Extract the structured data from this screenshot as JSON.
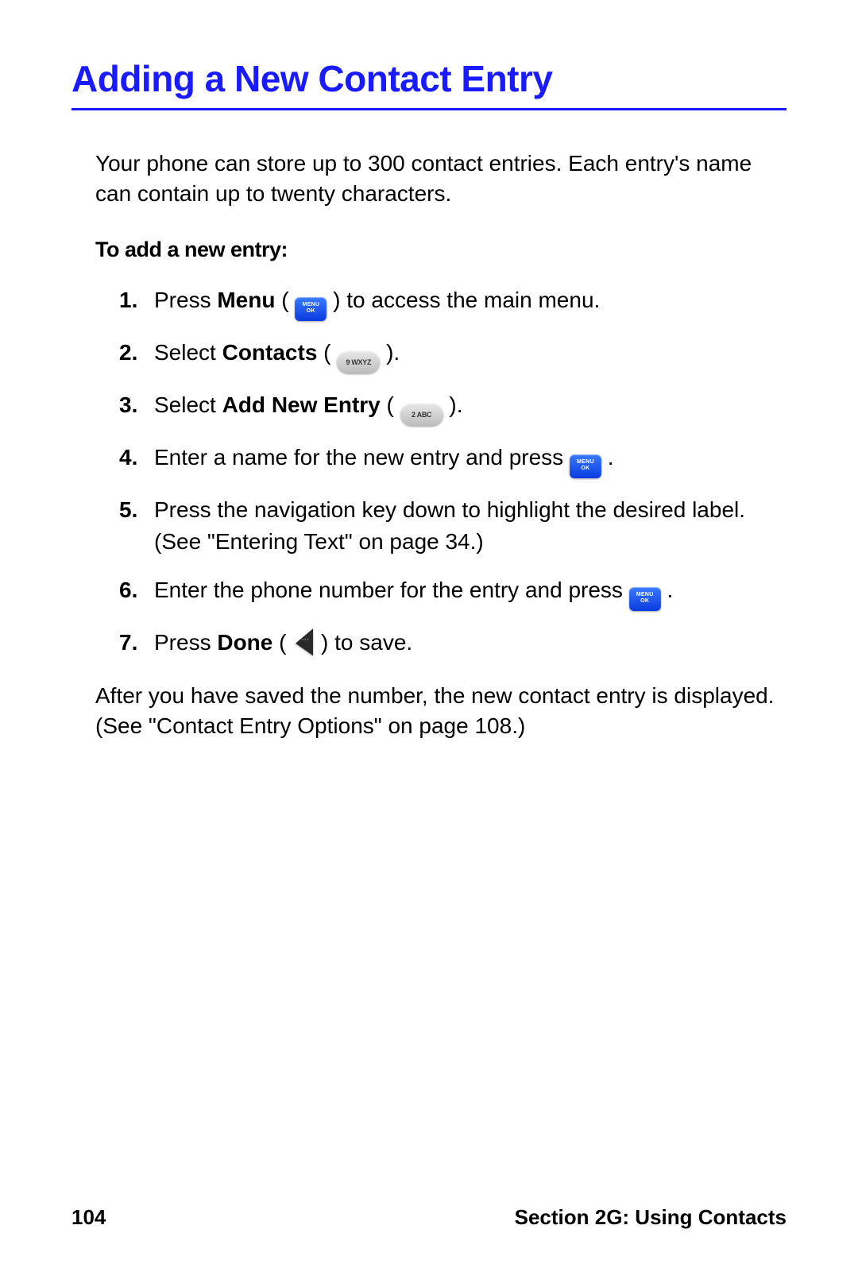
{
  "title": "Adding a New Contact Entry",
  "intro": "Your phone can store up to 300 contact entries. Each entry's name can contain up to twenty characters.",
  "subhead": "To add a new entry:",
  "steps": {
    "s1a": "Press ",
    "s1b": "Menu",
    "s1c": " ( ",
    "s1d": " ) to access the main menu.",
    "s2a": "Select ",
    "s2b": "Contacts",
    "s2c": " ( ",
    "s2d": " ).",
    "s3a": "Select ",
    "s3b": "Add New Entry",
    "s3c": " ( ",
    "s3d": " ).",
    "s4a": "Enter a name for the new entry and press ",
    "s4b": " .",
    "s5": "Press the navigation key down to highlight the desired label. (See \"Entering Text\" on page 34.)",
    "s6a": "Enter the phone number for the entry and press ",
    "s6b": " .",
    "s7a": "Press ",
    "s7b": "Done",
    "s7c": " ( ",
    "s7d": " ) to save."
  },
  "after": "After you have saved the number, the new contact entry is displayed. (See \"Contact Entry Options\" on page 108.)",
  "footer": {
    "page": "104",
    "section": "Section 2G: Using Contacts"
  },
  "keys": {
    "menuok_l1": "MENU",
    "menuok_l2": "OK",
    "nine": "9 WXYZ",
    "two": "2 ABC"
  }
}
